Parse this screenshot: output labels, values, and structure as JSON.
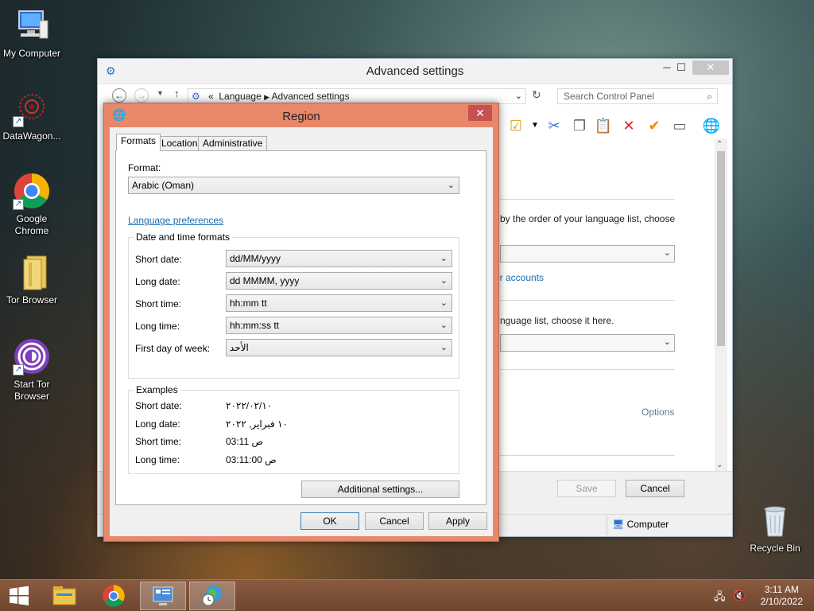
{
  "desktop": {
    "icons": [
      {
        "label": "My Computer",
        "icon": "computer-icon"
      },
      {
        "label": "DataWagon...",
        "icon": "datawagon-icon"
      },
      {
        "label": "Google\nChrome",
        "icon": "chrome-icon"
      },
      {
        "label": "Tor Browser",
        "icon": "folder-icon"
      },
      {
        "label": "Start Tor\nBrowser",
        "icon": "tor-icon"
      },
      {
        "label": "Recycle Bin",
        "icon": "recycle-bin-icon"
      }
    ]
  },
  "advanced_window": {
    "title": "Advanced settings",
    "breadcrumb": {
      "prefix": "«",
      "items": [
        "Language",
        "Advanced settings"
      ]
    },
    "search_placeholder": "Search Control Panel",
    "body_text_1": "by the order of your language list, choose",
    "body_link_1": "er accounts",
    "body_text_2": "nguage list, choose it here.",
    "options_link": "Options",
    "save_label": "Save",
    "cancel_label": "Cancel",
    "status_computer": "Computer"
  },
  "region": {
    "title": "Region",
    "tabs": [
      "Formats",
      "Location",
      "Administrative"
    ],
    "format_label": "Format:",
    "format_value": "Arabic (Oman)",
    "language_prefs_link": "Language preferences",
    "date_time_group": "Date and time formats",
    "rows": [
      {
        "label": "Short date:",
        "value": "dd/MM/yyyy"
      },
      {
        "label": "Long date:",
        "value": "dd MMMM, yyyy"
      },
      {
        "label": "Short time:",
        "value": "hh:mm tt"
      },
      {
        "label": "Long time:",
        "value": "hh:mm:ss tt"
      },
      {
        "label": "First day of week:",
        "value": "الأحد"
      }
    ],
    "examples_group": "Examples",
    "examples": [
      {
        "label": "Short date:",
        "value": "٢٠٢٢/٠٢/١٠"
      },
      {
        "label": "Long date:",
        "value": "١٠ فبراير, ٢٠٢٢"
      },
      {
        "label": "Short time:",
        "value": "03:11 ص"
      },
      {
        "label": "Long time:",
        "value": "03:11:00 ص"
      }
    ],
    "additional_settings": "Additional settings...",
    "ok": "OK",
    "cancel": "Cancel",
    "apply": "Apply"
  },
  "taskbar": {
    "time": "3:11 AM",
    "date": "2/10/2022"
  },
  "colors": {
    "region_frame": "#e8876a",
    "taskbar": "#7a4e36",
    "link": "#1b6cb0"
  }
}
